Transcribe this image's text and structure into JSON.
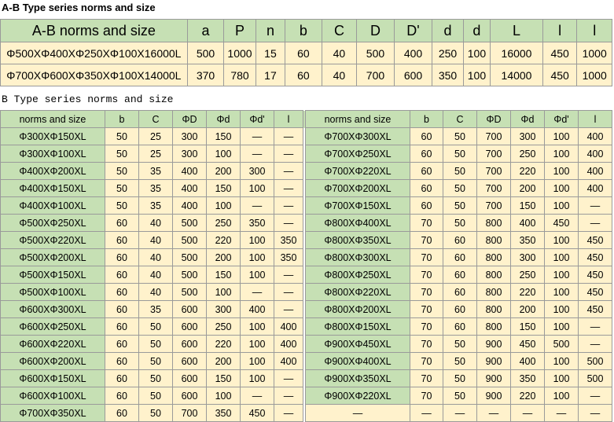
{
  "ab_title": "A-B Type series norms and size",
  "ab_headers": [
    "A-B norms and size",
    "a",
    "P",
    "n",
    "b",
    "C",
    "D",
    "D'",
    "d",
    "d",
    "L",
    "l",
    "l"
  ],
  "ab_rows": [
    [
      "Φ500XΦ400XΦ250XΦ100X16000L",
      "500",
      "1000",
      "15",
      "60",
      "40",
      "500",
      "400",
      "250",
      "100",
      "16000",
      "450",
      "1000"
    ],
    [
      "Φ700XΦ600XΦ350XΦ100X14000L",
      "370",
      "780",
      "17",
      "60",
      "40",
      "700",
      "600",
      "350",
      "100",
      "14000",
      "450",
      "1000"
    ]
  ],
  "b_title": "B Type series norms and size",
  "b_headers": [
    "norms and size",
    "b",
    "C",
    "ΦD",
    "Φd",
    "Φd'",
    "l"
  ],
  "b_left_rows": [
    [
      "Φ300XΦ150XL",
      "50",
      "25",
      "300",
      "150",
      "—",
      "—"
    ],
    [
      "Φ300XΦ100XL",
      "50",
      "25",
      "300",
      "100",
      "—",
      "—"
    ],
    [
      "Φ400XΦ200XL",
      "50",
      "35",
      "400",
      "200",
      "300",
      "—"
    ],
    [
      "Φ400XΦ150XL",
      "50",
      "35",
      "400",
      "150",
      "100",
      "—"
    ],
    [
      "Φ400XΦ100XL",
      "50",
      "35",
      "400",
      "100",
      "—",
      "—"
    ],
    [
      "Φ500XΦ250XL",
      "60",
      "40",
      "500",
      "250",
      "350",
      "—"
    ],
    [
      "Φ500XΦ220XL",
      "60",
      "40",
      "500",
      "220",
      "100",
      "350"
    ],
    [
      "Φ500XΦ200XL",
      "60",
      "40",
      "500",
      "200",
      "100",
      "350"
    ],
    [
      "Φ500XΦ150XL",
      "60",
      "40",
      "500",
      "150",
      "100",
      "—"
    ],
    [
      "Φ500XΦ100XL",
      "60",
      "40",
      "500",
      "100",
      "—",
      "—"
    ],
    [
      "Φ600XΦ300XL",
      "60",
      "35",
      "600",
      "300",
      "400",
      "—"
    ],
    [
      "Φ600XΦ250XL",
      "60",
      "50",
      "600",
      "250",
      "100",
      "400"
    ],
    [
      "Φ600XΦ220XL",
      "60",
      "50",
      "600",
      "220",
      "100",
      "400"
    ],
    [
      "Φ600XΦ200XL",
      "60",
      "50",
      "600",
      "200",
      "100",
      "400"
    ],
    [
      "Φ600XΦ150XL",
      "60",
      "50",
      "600",
      "150",
      "100",
      "—"
    ],
    [
      "Φ600XΦ100XL",
      "60",
      "50",
      "600",
      "100",
      "—",
      "—"
    ],
    [
      "Φ700XΦ350XL",
      "60",
      "50",
      "700",
      "350",
      "450",
      "—"
    ]
  ],
  "b_right_rows": [
    [
      "Φ700XΦ300XL",
      "60",
      "50",
      "700",
      "300",
      "100",
      "400"
    ],
    [
      "Φ700XΦ250XL",
      "60",
      "50",
      "700",
      "250",
      "100",
      "400"
    ],
    [
      "Φ700XΦ220XL",
      "60",
      "50",
      "700",
      "220",
      "100",
      "400"
    ],
    [
      "Φ700XΦ200XL",
      "60",
      "50",
      "700",
      "200",
      "100",
      "400"
    ],
    [
      "Φ700XΦ150XL",
      "60",
      "50",
      "700",
      "150",
      "100",
      "—"
    ],
    [
      "Φ800XΦ400XL",
      "70",
      "50",
      "800",
      "400",
      "450",
      "—"
    ],
    [
      "Φ800XΦ350XL",
      "70",
      "60",
      "800",
      "350",
      "100",
      "450"
    ],
    [
      "Φ800XΦ300XL",
      "70",
      "60",
      "800",
      "300",
      "100",
      "450"
    ],
    [
      "Φ800XΦ250XL",
      "70",
      "60",
      "800",
      "250",
      "100",
      "450"
    ],
    [
      "Φ800XΦ220XL",
      "70",
      "60",
      "800",
      "220",
      "100",
      "450"
    ],
    [
      "Φ800XΦ200XL",
      "70",
      "60",
      "800",
      "200",
      "100",
      "450"
    ],
    [
      "Φ800XΦ150XL",
      "70",
      "60",
      "800",
      "150",
      "100",
      "—"
    ],
    [
      "Φ900XΦ450XL",
      "70",
      "50",
      "900",
      "450",
      "500",
      "—"
    ],
    [
      "Φ900XΦ400XL",
      "70",
      "50",
      "900",
      "400",
      "100",
      "500"
    ],
    [
      "Φ900XΦ350XL",
      "70",
      "50",
      "900",
      "350",
      "100",
      "500"
    ],
    [
      "Φ900XΦ220XL",
      "70",
      "50",
      "900",
      "220",
      "100",
      "—"
    ],
    [
      "—",
      "—",
      "—",
      "—",
      "—",
      "—",
      "—"
    ]
  ]
}
